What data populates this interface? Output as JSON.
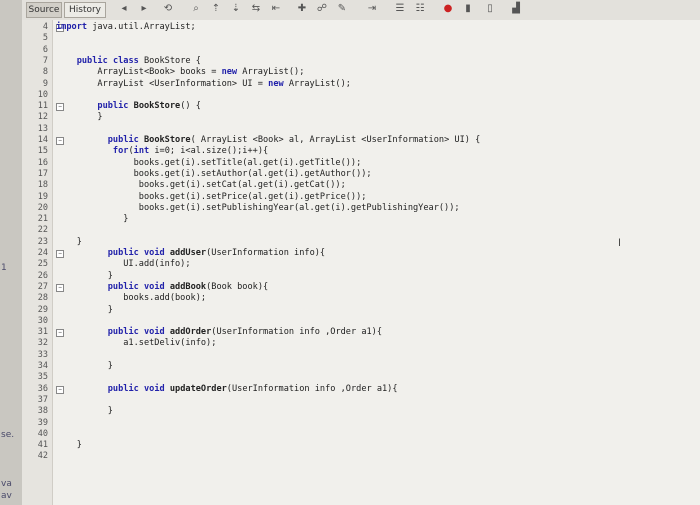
{
  "toolbar": {
    "tab_source": "Source",
    "tab_history": "History"
  },
  "left_strip": [
    "1",
    "se.",
    "va",
    "av"
  ],
  "icons": [
    "back-icon",
    "forward-icon",
    "search-icon",
    "prev-icon",
    "next-icon",
    "toggle-icon",
    "bookmark-icon",
    "comment-icon",
    "run-icon",
    "stop-icon",
    "chart-icon"
  ],
  "gutter_lines": [
    "4",
    "5",
    "6",
    "7",
    "8",
    "9",
    "10",
    "11",
    "12",
    "13",
    "14",
    "15",
    "16",
    "17",
    "18",
    "19",
    "20",
    "21",
    "22",
    "23",
    "24",
    "25",
    "26",
    "27",
    "28",
    "29",
    "30",
    "31",
    "32",
    "33",
    "34",
    "35",
    "36",
    "37",
    "38",
    "39",
    "40",
    "41",
    "42"
  ],
  "code": [
    {
      "n": "4",
      "text": "import java.util.ArrayList;"
    },
    {
      "n": "5",
      "text": ""
    },
    {
      "n": "6",
      "text": ""
    },
    {
      "n": "7",
      "text": "    public class BookStore {"
    },
    {
      "n": "8",
      "text": "        ArrayList<Book> books = new ArrayList();"
    },
    {
      "n": "9",
      "text": "        ArrayList <UserInformation> UI = new ArrayList();"
    },
    {
      "n": "10",
      "text": ""
    },
    {
      "n": "11",
      "text": "        public BookStore() {"
    },
    {
      "n": "12",
      "text": "        }"
    },
    {
      "n": "13",
      "text": ""
    },
    {
      "n": "14",
      "text": "          public BookStore( ArrayList <Book> al, ArrayList <UserInformation> UI) {"
    },
    {
      "n": "15",
      "text": "           for(int i=0; i<al.size();i++){"
    },
    {
      "n": "16",
      "text": "               books.get(i).setTitle(al.get(i).getTitle());"
    },
    {
      "n": "17",
      "text": "               books.get(i).setAuthor(al.get(i).getAuthor());"
    },
    {
      "n": "18",
      "text": "                books.get(i).setCat(al.get(i).getCat());"
    },
    {
      "n": "19",
      "text": "                books.get(i).setPrice(al.get(i).getPrice());"
    },
    {
      "n": "20",
      "text": "                books.get(i).setPublishingYear(al.get(i).getPublishingYear());"
    },
    {
      "n": "21",
      "text": "             }"
    },
    {
      "n": "22",
      "text": ""
    },
    {
      "n": "23",
      "text": "    }"
    },
    {
      "n": "24",
      "text": "          public void addUser(UserInformation info){"
    },
    {
      "n": "25",
      "text": "             UI.add(info);"
    },
    {
      "n": "26",
      "text": "          }"
    },
    {
      "n": "27",
      "text": "          public void addBook(Book book){"
    },
    {
      "n": "28",
      "text": "             books.add(book);"
    },
    {
      "n": "29",
      "text": "          }"
    },
    {
      "n": "30",
      "text": ""
    },
    {
      "n": "31",
      "text": "          public void addOrder(UserInformation info ,Order a1){"
    },
    {
      "n": "32",
      "text": "             a1.setDeliv(info);"
    },
    {
      "n": "33",
      "text": ""
    },
    {
      "n": "34",
      "text": "          }"
    },
    {
      "n": "35",
      "text": ""
    },
    {
      "n": "36",
      "text": "          public void updateOrder(UserInformation info ,Order a1){"
    },
    {
      "n": "37",
      "text": ""
    },
    {
      "n": "38",
      "text": "          }"
    },
    {
      "n": "39",
      "text": ""
    },
    {
      "n": "40",
      "text": ""
    },
    {
      "n": "41",
      "text": "    }"
    },
    {
      "n": "42",
      "text": ""
    }
  ]
}
